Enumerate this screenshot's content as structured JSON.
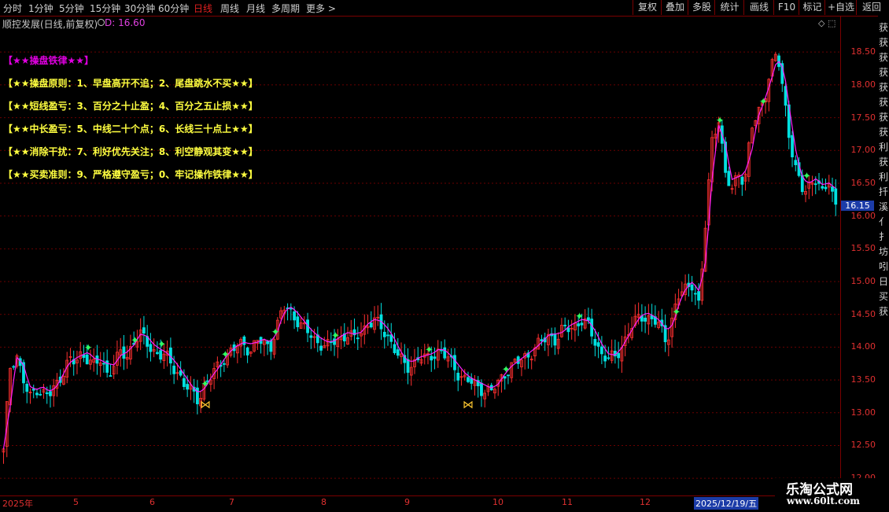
{
  "toolbar": {
    "periods": [
      "分时",
      "1分钟",
      "5分钟",
      "15分钟",
      "30分钟",
      "60分钟",
      "日线",
      "周线",
      "月线",
      "多周期",
      "更多 >"
    ],
    "active_period": "日线",
    "buttons": [
      "复权",
      "叠加",
      "多股",
      "统计",
      "画线",
      "F10",
      "标记",
      "+自选",
      "返回"
    ]
  },
  "info": {
    "stock_name": "顺控发展(日线,前复权)",
    "d_label": "D: 16.60"
  },
  "colors": {
    "up": "#ff3030",
    "down": "#00e0e0",
    "ma": "#ff20ff",
    "grid": "#6a0000",
    "axis": "#e03030",
    "signal_up": "#30ff60"
  },
  "price_axis": {
    "ticks": [
      "18.50",
      "18.00",
      "17.50",
      "17.00",
      "16.50",
      "16.00",
      "15.50",
      "15.00",
      "14.50",
      "14.00",
      "13.50",
      "13.00",
      "12.50",
      "12.00"
    ],
    "current": "16.15"
  },
  "date_axis": {
    "labels": [
      "2025年",
      "5",
      "6",
      "7",
      "8",
      "9",
      "10",
      "11",
      "12"
    ],
    "current_date": "2025/12/19/五"
  },
  "rules": {
    "title": "【★★操盘铁律★★】",
    "lines": [
      "【★★操盘原则：1、早盘高开不追；2、尾盘跳水不买★★】",
      "【★★短线盈亏：3、百分之十止盈；4、百分之五止损★★】",
      "【★★中长盈亏：5、中线二十个点；6、长线三十点上★★】",
      "【★★消除干扰：7、利好优先关注；8、利空静观其变★★】",
      "【★★买卖准则：9、严格遵守盈亏；0、牢记操作铁律★★】"
    ]
  },
  "side_strip": [
    "获",
    "获",
    "获",
    "获",
    "获",
    "获",
    "获",
    "获",
    "利",
    "获",
    "利",
    "扦",
    "溪",
    "亻",
    "扌",
    "坊",
    "吲",
    "日",
    "买",
    "获"
  ],
  "watermark": {
    "title": "乐淘公式网",
    "url": "www.60lt.com"
  },
  "chart_data": {
    "type": "candlestick",
    "y_range": [
      11.75,
      18.85
    ],
    "closes": [
      12.4,
      13.7,
      13.9,
      13.5,
      13.2,
      13.4,
      13.3,
      13.25,
      13.4,
      13.6,
      13.8,
      13.75,
      13.9,
      13.85,
      13.7,
      13.8,
      13.6,
      13.75,
      13.9,
      13.85,
      14.1,
      14.2,
      14.05,
      13.95,
      13.9,
      13.85,
      13.7,
      13.6,
      13.4,
      13.3,
      13.2,
      13.45,
      13.55,
      13.7,
      13.85,
      13.95,
      14.0,
      14.05,
      13.95,
      14.1,
      14.05,
      14.0,
      14.3,
      14.6,
      14.55,
      14.45,
      14.3,
      14.2,
      14.1,
      14.05,
      14.0,
      14.1,
      14.15,
      14.2,
      14.1,
      14.25,
      14.35,
      14.4,
      14.3,
      14.2,
      14.0,
      13.8,
      13.7,
      13.75,
      13.85,
      13.8,
      13.9,
      13.95,
      13.85,
      13.75,
      13.6,
      13.5,
      13.45,
      13.4,
      13.35,
      13.3,
      13.45,
      13.6,
      13.7,
      13.75,
      13.85,
      13.9,
      14.0,
      14.1,
      14.2,
      14.1,
      14.25,
      14.3,
      14.35,
      14.4,
      14.3,
      14.1,
      13.9,
      13.8,
      13.85,
      14.0,
      14.2,
      14.35,
      14.5,
      14.45,
      14.4,
      14.3,
      14.1,
      14.5,
      14.8,
      14.9,
      15.0,
      14.6,
      15.9,
      17.2,
      17.5,
      16.6,
      16.4,
      16.7,
      16.5,
      17.3,
      17.6,
      17.8,
      18.2,
      18.5,
      17.9,
      17.1,
      16.6,
      16.4,
      16.5,
      16.55,
      16.3,
      16.6,
      16.15
    ],
    "ma_legend": "",
    "signals": {
      "up_markers": 14,
      "butterfly_markers": 2
    }
  }
}
